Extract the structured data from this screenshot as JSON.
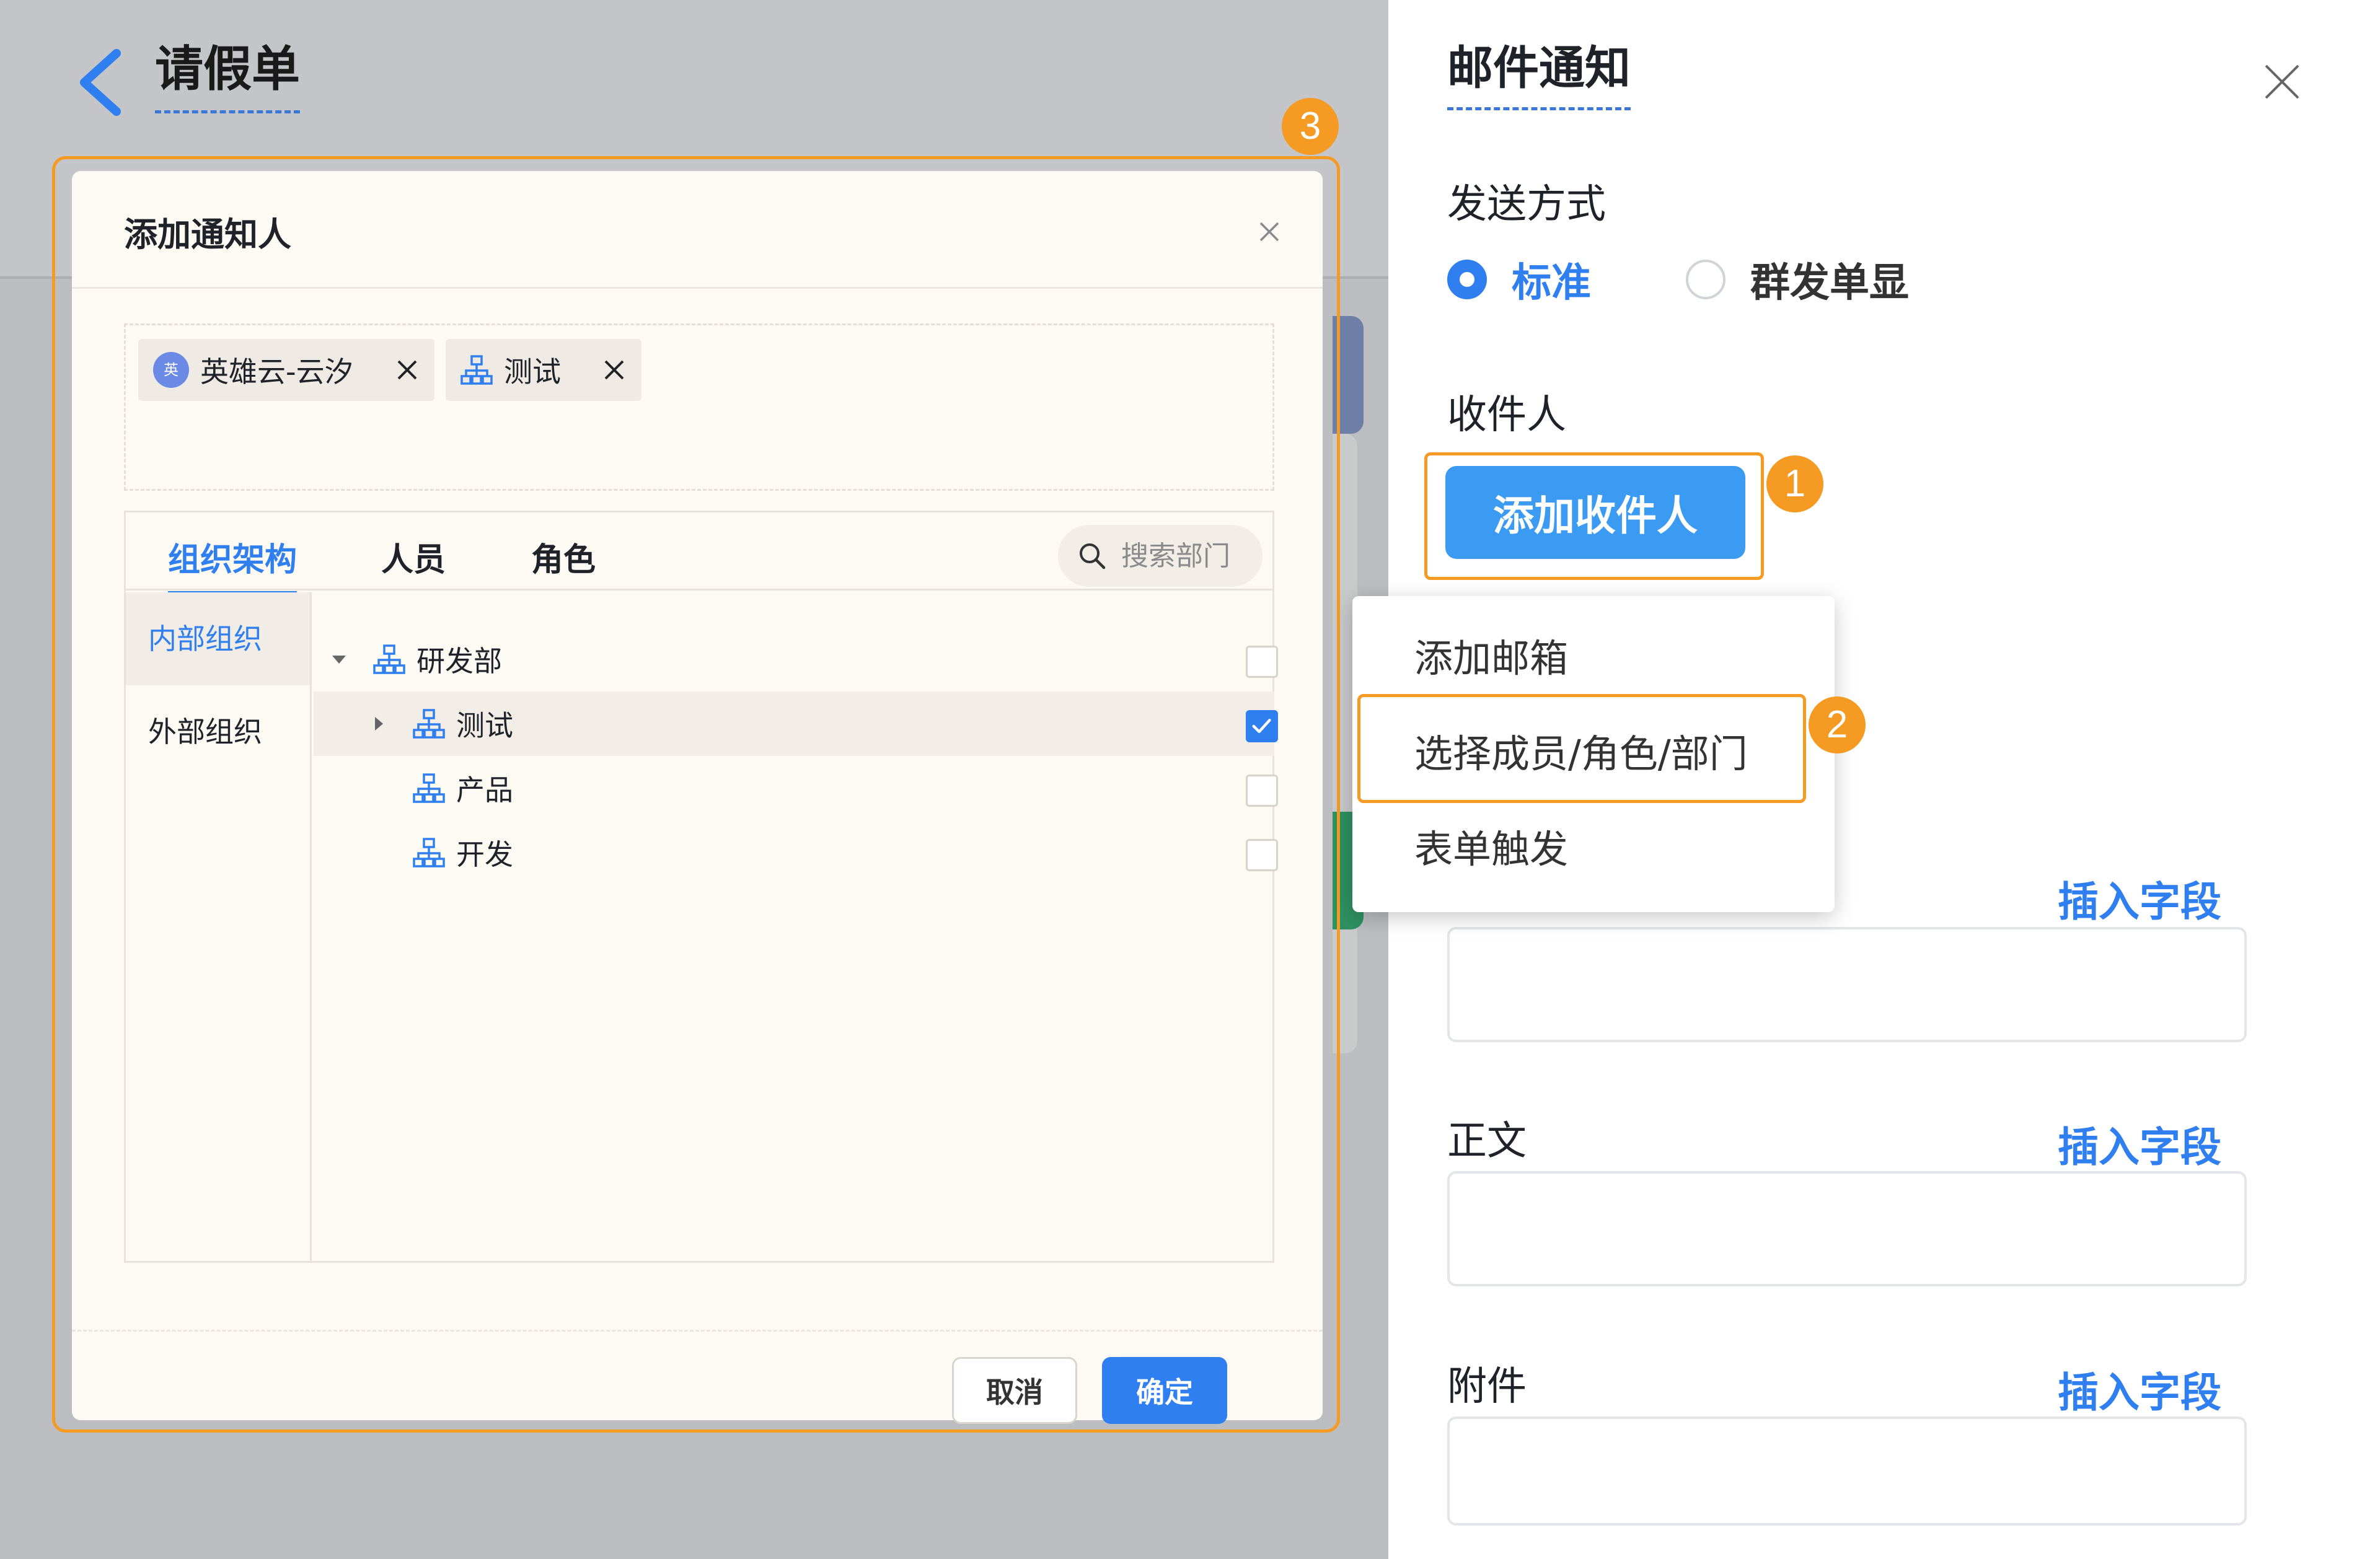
{
  "background_page": {
    "title": "请假单"
  },
  "dialog": {
    "title": "添加通知人",
    "selected": [
      {
        "avatar_text": "英",
        "label": "英雄云-云汐"
      },
      {
        "label": "测试"
      }
    ],
    "tabs": [
      {
        "label": "组织架构"
      },
      {
        "label": "人员"
      },
      {
        "label": "角色"
      }
    ],
    "search_placeholder": "搜索部门",
    "side_nav": [
      {
        "label": "内部组织"
      },
      {
        "label": "外部组织"
      }
    ],
    "tree": [
      {
        "label": "研发部",
        "checked": false
      },
      {
        "label": "测试",
        "checked": true
      },
      {
        "label": "产品",
        "checked": false
      },
      {
        "label": "开发",
        "checked": false
      }
    ],
    "cancel_label": "取消",
    "ok_label": "确定"
  },
  "drawer": {
    "title": "邮件通知",
    "send_mode_label": "发送方式",
    "send_modes": [
      {
        "label": "标准",
        "selected": true
      },
      {
        "label": "群发单显",
        "selected": false
      }
    ],
    "recipients_label": "收件人",
    "add_recipient_label": "添加收件人",
    "dropdown": [
      {
        "label": "添加邮箱"
      },
      {
        "label": "选择成员/角色/部门"
      },
      {
        "label": "表单触发"
      }
    ],
    "insert_field_label": "插入字段",
    "body_label": "正文",
    "attachment_label": "附件"
  },
  "annotations": {
    "badge_1": "1",
    "badge_2": "2",
    "badge_3": "3"
  },
  "colors": {
    "accent": "#2f7ff0",
    "highlight": "#f59a23"
  }
}
